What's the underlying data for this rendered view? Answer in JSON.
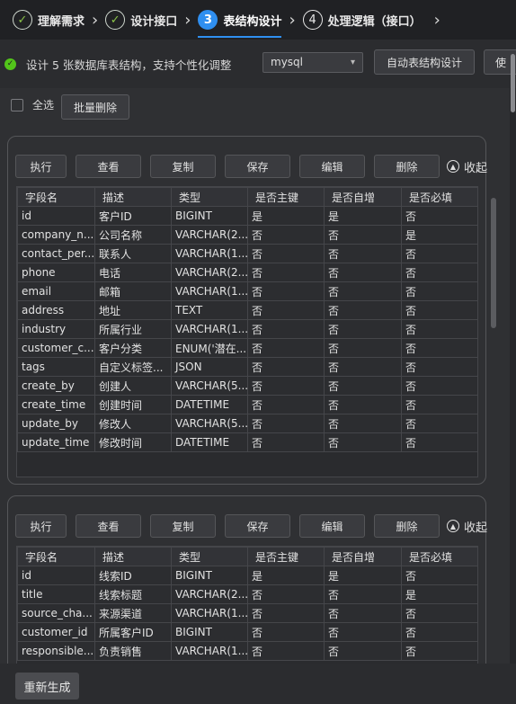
{
  "steps": [
    {
      "num": "✓",
      "label": "理解需求",
      "state": "done"
    },
    {
      "num": "✓",
      "label": "设计接口",
      "state": "done"
    },
    {
      "num": "3",
      "label": "表结构设计",
      "state": "active"
    },
    {
      "num": "4",
      "label": "处理逻辑（接口）",
      "state": "pending"
    }
  ],
  "info": {
    "text": "设计 5 张数据库表结构，支持个性化调整",
    "db_select": "mysql",
    "auto_btn": "自动表结构设计",
    "cut_btn": "使"
  },
  "toolbar": {
    "select_all": "全选",
    "batch_delete": "批量删除"
  },
  "card_actions": {
    "execute": "执行",
    "view": "查看",
    "copy": "复制",
    "save": "保存",
    "edit": "编辑",
    "delete": "删除",
    "collapse": "收起"
  },
  "columns": [
    "字段名",
    "描述",
    "类型",
    "是否主键",
    "是否自增",
    "是否必填"
  ],
  "tables": [
    {
      "rows": [
        [
          "id",
          "客户ID",
          "BIGINT",
          "是",
          "是",
          "否"
        ],
        [
          "company_n...",
          "公司名称",
          "VARCHAR(2...",
          "否",
          "否",
          "是"
        ],
        [
          "contact_per...",
          "联系人",
          "VARCHAR(1...",
          "否",
          "否",
          "否"
        ],
        [
          "phone",
          "电话",
          "VARCHAR(2...",
          "否",
          "否",
          "否"
        ],
        [
          "email",
          "邮箱",
          "VARCHAR(1...",
          "否",
          "否",
          "否"
        ],
        [
          "address",
          "地址",
          "TEXT",
          "否",
          "否",
          "否"
        ],
        [
          "industry",
          "所属行业",
          "VARCHAR(1...",
          "否",
          "否",
          "否"
        ],
        [
          "customer_c...",
          "客户分类",
          "ENUM('潜在...",
          "否",
          "否",
          "否"
        ],
        [
          "tags",
          "自定义标签...",
          "JSON",
          "否",
          "否",
          "否"
        ],
        [
          "create_by",
          "创建人",
          "VARCHAR(5...",
          "否",
          "否",
          "否"
        ],
        [
          "create_time",
          "创建时间",
          "DATETIME",
          "否",
          "否",
          "否"
        ],
        [
          "update_by",
          "修改人",
          "VARCHAR(5...",
          "否",
          "否",
          "否"
        ],
        [
          "update_time",
          "修改时间",
          "DATETIME",
          "否",
          "否",
          "否"
        ]
      ]
    },
    {
      "rows": [
        [
          "id",
          "线索ID",
          "BIGINT",
          "是",
          "是",
          "否"
        ],
        [
          "title",
          "线索标题",
          "VARCHAR(2...",
          "否",
          "否",
          "是"
        ],
        [
          "source_cha...",
          "来源渠道",
          "VARCHAR(1...",
          "否",
          "否",
          "否"
        ],
        [
          "customer_id",
          "所属客户ID",
          "BIGINT",
          "否",
          "否",
          "否"
        ],
        [
          "responsible...",
          "负责销售",
          "VARCHAR(1...",
          "否",
          "否",
          "否"
        ]
      ]
    }
  ],
  "footer": {
    "regenerate": "重新生成"
  }
}
